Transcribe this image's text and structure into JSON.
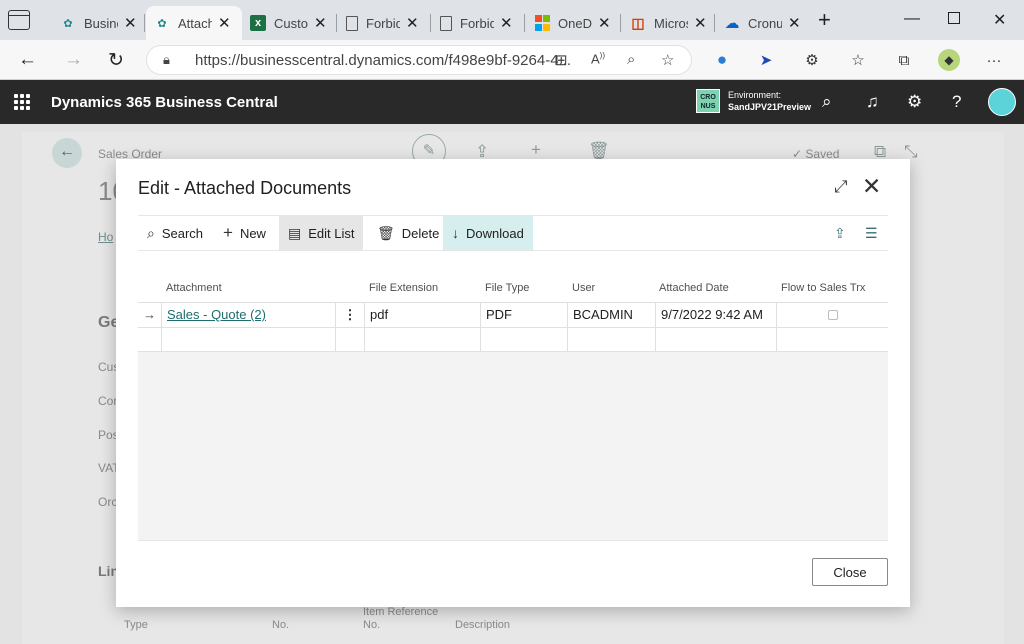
{
  "browser": {
    "tabs": [
      {
        "title": "Business Central",
        "favicon": "bc-icon",
        "active": false
      },
      {
        "title": "Attached Documents",
        "favicon": "bc-icon",
        "active": true
      },
      {
        "title": "Customers",
        "favicon": "excel-icon",
        "active": false
      },
      {
        "title": "Forbidden",
        "favicon": "page-icon",
        "active": false
      },
      {
        "title": "Forbidden",
        "favicon": "page-icon",
        "active": false
      },
      {
        "title": "OneDrive",
        "favicon": "microsoft-icon",
        "active": false
      },
      {
        "title": "Microsoft",
        "favicon": "office-icon",
        "active": false
      },
      {
        "title": "Cronus",
        "favicon": "onedrive-cloud-icon",
        "active": false
      }
    ],
    "url": "https://businesscentral.dynamics.com/f498e9bf-9264-4..."
  },
  "app": {
    "name": "Dynamics 365 Business Central",
    "company_badge": "CRO NUS",
    "environment_label": "Environment:",
    "environment_name": "SandJPV21Preview"
  },
  "background_page": {
    "breadcrumb": "Sales Order",
    "title_fragment": "10",
    "tab_fragment": "Ho",
    "section_fragment": "Ge",
    "field_fragments": [
      "Cus",
      "Cor",
      "Pos",
      "VAT",
      "Orc"
    ],
    "lines_fragment": "Lin",
    "saved_label": "Saved",
    "lines_columns": [
      "Type",
      "No.",
      "Item Reference No.",
      "Description"
    ]
  },
  "dialog": {
    "title": "Edit - Attached Documents",
    "commands": {
      "search": "Search",
      "new": "New",
      "edit_list": "Edit List",
      "delete": "Delete",
      "download": "Download"
    },
    "columns": {
      "attachment": "Attachment",
      "file_extension": "File Extension",
      "file_type": "File Type",
      "user": "User",
      "attached_date": "Attached Date",
      "flow_to_sales_trx": "Flow to Sales Trx"
    },
    "rows": [
      {
        "attachment": "Sales - Quote (2)",
        "file_extension": "pdf",
        "file_type": "PDF",
        "user": "BCADMIN",
        "attached_date": "9/7/2022 9:42 AM",
        "flow_to_sales_trx": false
      }
    ],
    "close_label": "Close"
  },
  "colors": {
    "app_bar": "#292929",
    "accent_teal": "#1f6e6e",
    "download_highlight": "#d6eeee",
    "edit_list_highlight": "#e6e6e6"
  }
}
